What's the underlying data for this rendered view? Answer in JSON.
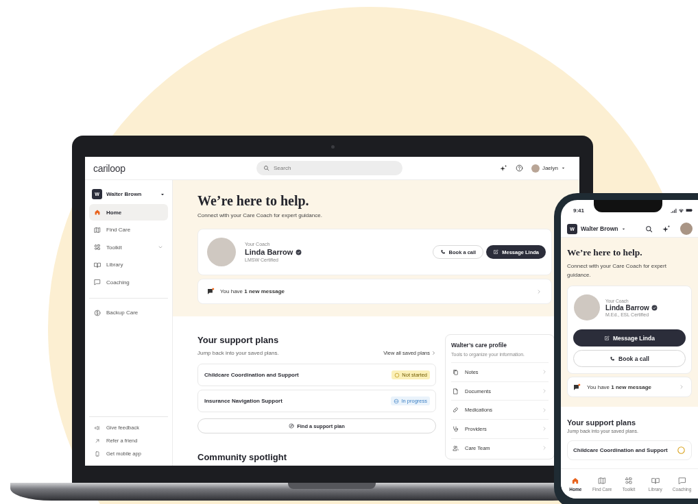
{
  "laptop": {
    "topbar": {
      "logo": "cariloop",
      "search": {
        "placeholder": "Search"
      },
      "user": "Jaelyn"
    },
    "sidebar": {
      "account": {
        "initial": "W",
        "name": "Walter Brown"
      },
      "items": [
        {
          "label": "Home",
          "kind": "link",
          "selected": true
        },
        {
          "label": "Find Care",
          "kind": "link",
          "selected": false
        },
        {
          "label": "Toolkit",
          "kind": "group",
          "selected": false
        },
        {
          "label": "Library",
          "kind": "link",
          "selected": false
        },
        {
          "label": "Coaching",
          "kind": "link",
          "selected": false
        }
      ],
      "extra_items": [
        {
          "label": "Backup Care"
        }
      ],
      "footer_links": [
        {
          "label": "Give feedback"
        },
        {
          "label": "Refer a friend"
        },
        {
          "label": "Get mobile app"
        }
      ]
    },
    "hero": {
      "title": "We’re here to help.",
      "subtitle": "Connect with your Care Coach for expert guidance.",
      "coach": {
        "eyebrow": "Your Coach",
        "name": "Linda Barrow",
        "credentials": "LMSW Certified",
        "verified": true,
        "actions": [
          {
            "label": "Book a call",
            "kind": "outline"
          },
          {
            "label": "Message Linda",
            "kind": "primary"
          }
        ]
      },
      "message": "You have **1 new message**"
    },
    "support_plans": {
      "title": "Your support plans",
      "subtitle": "Jump back into your saved plans.",
      "view_all": "View all saved plans",
      "plans": [
        {
          "name": "Childcare Coordination and Support",
          "status": "Not started",
          "kind": "not_started"
        },
        {
          "name": "Insurance Navigation Support",
          "status": "In progress",
          "kind": "in_progress"
        }
      ],
      "find_button": "Find a support plan"
    },
    "care_profile": {
      "title": "Walter’s care profile",
      "subtitle": "Tools to organize your information.",
      "items": [
        "Notes",
        "Documents",
        "Medications",
        "Providers",
        "Care Team"
      ]
    },
    "community": {
      "title": "Community spotlight"
    }
  },
  "phone": {
    "time": "9:41",
    "account": {
      "initial": "W",
      "name": "Walter Brown"
    },
    "hero": {
      "title": "We’re here to help.",
      "subtitle": "Connect with your Care Coach for expert guidance.",
      "coach": {
        "eyebrow": "Your Coach",
        "name": "Linda Barrow",
        "credentials": "M.Ed., ESL Certified",
        "verified": true,
        "actions": [
          {
            "label": "Message Linda",
            "kind": "primary"
          },
          {
            "label": "Book a call",
            "kind": "outline"
          }
        ]
      },
      "message": "You have **1 new message**"
    },
    "support_plans": {
      "title": "Your support plans",
      "subtitle": "Jump back into your saved plans.",
      "plans": [
        {
          "name": "Childcare Coordination and Support",
          "kind": "not_started"
        }
      ]
    },
    "tabs": [
      {
        "label": "Home",
        "selected": true
      },
      {
        "label": "Find Care",
        "selected": false
      },
      {
        "label": "Toolkit",
        "selected": false
      },
      {
        "label": "Library",
        "selected": false
      },
      {
        "label": "Coaching",
        "selected": false
      }
    ]
  }
}
